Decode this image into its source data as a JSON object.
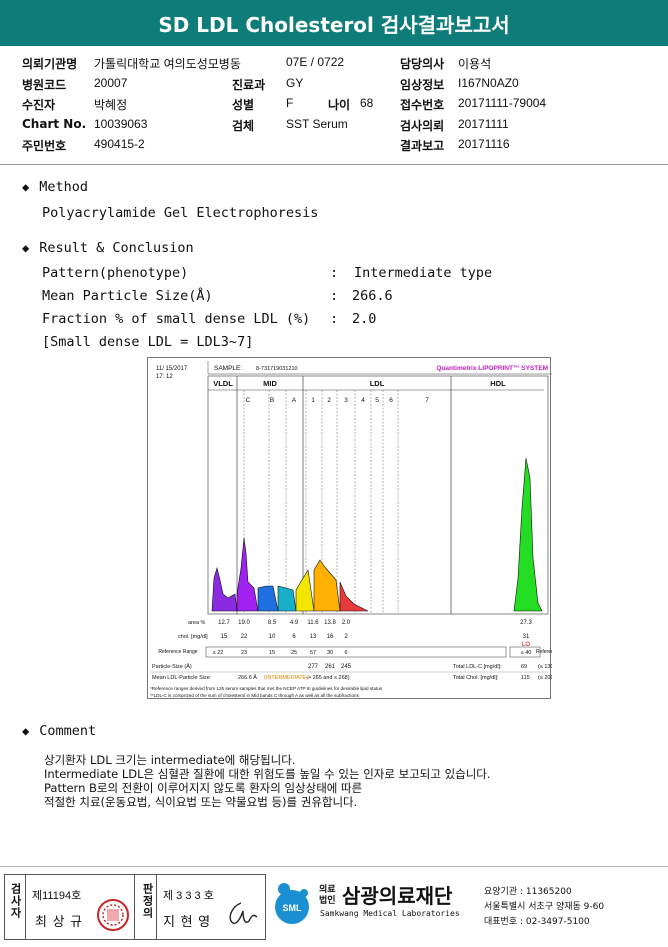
{
  "title": "SD LDL Cholesterol 검사결과보고서",
  "info": {
    "rows": [
      [
        {
          "l": "의뢰기관명",
          "v": "가톨릭대학교 여의도성모병동"
        },
        {
          "l": "",
          "v": "07E / 0722"
        },
        {
          "l": "담당의사",
          "v": "이용석"
        }
      ],
      [
        {
          "l": "병원코드",
          "v": "20007"
        },
        {
          "l": "진료과",
          "v": "GY"
        },
        {
          "l": "임상정보",
          "v": "I167N0AZ0"
        }
      ],
      [
        {
          "l": "수진자",
          "v": "박혜정"
        },
        {
          "l": "성별",
          "v": "F"
        },
        {
          "l": "접수번호",
          "v": "20171111-79004"
        }
      ],
      [
        {
          "l": "Chart No.",
          "v": "10039063"
        },
        {
          "l": "검체",
          "v": "SST Serum"
        },
        {
          "l": "검사의뢰",
          "v": "20171111"
        }
      ],
      [
        {
          "l": "주민번호",
          "v": "490415-2"
        },
        {
          "l": "",
          "v": ""
        },
        {
          "l": "결과보고",
          "v": "20171116"
        }
      ]
    ],
    "age_label": "나이",
    "age_value": "68"
  },
  "method": {
    "heading": "Method",
    "text": "Polyacrylamide Gel Electrophoresis"
  },
  "result": {
    "heading": "Result & Conclusion",
    "items": [
      {
        "label": "Pattern(phenotype)",
        "value": "Intermediate type"
      },
      {
        "label": "Mean Particle Size(Å)",
        "value": "266.6"
      },
      {
        "label": "Fraction % of small dense LDL (%)",
        "value": "2.0"
      }
    ],
    "note": "[Small dense LDL = LDL3~7]"
  },
  "graph": {
    "date": "11/ 15/2017",
    "time": "17: 12",
    "sample_label": "SAMPLE:",
    "sample_id": "8-731719031210",
    "system": "Quantimetrix LIPOPRINT™ SYSTEM",
    "groups": [
      "VLDL",
      "MID",
      "LDL",
      "HDL"
    ],
    "bands": [
      "C",
      "B",
      "A",
      "1",
      "2",
      "3",
      "4",
      "5",
      "6",
      "7"
    ],
    "area_label": "area %",
    "area_values": [
      "12.7",
      "19.0",
      "8.5",
      "4.9",
      "11.6",
      "13.8",
      "2.0",
      "27.3"
    ],
    "chol_label": "chol. [mg/dl]",
    "chol_values": [
      "15",
      "22",
      "10",
      "6",
      "13",
      "16",
      "2",
      "31"
    ],
    "lo_label": "LO",
    "ref_label": "Reference Range",
    "ref_values": [
      "≤ 22",
      "23",
      "15",
      "25",
      "57",
      "30",
      "6",
      "≥ 40"
    ],
    "particle_label": "Particle-Size (Å)",
    "particle_values": [
      "277",
      "261",
      "245"
    ],
    "mean_label": "Mean LDL-Particle Size:",
    "mean_value": "266.6 Å",
    "mean_type": "(INTERMEDIATE)",
    "mean_range": "-> 265 and ≤ 268)",
    "total_ldl_label": "Total LDL-C [mg/dl]:",
    "total_ldl_value": "69",
    "total_ldl_ref": "(≤ 130)",
    "total_chol_label": "Total Chol. [mg/dl]:",
    "total_chol_value": "115",
    "total_chol_ref": "(≤ 200)",
    "footnote1": "*Reference ranges derived from 125 serum samples that met the NCEP ATP III guidelines for desirable lipid status",
    "footnote2": "**LDL-C is comprized of the sum of cholesterol in Mid bands C through A as well as all the subfractions"
  },
  "comment": {
    "heading": "Comment",
    "lines": [
      "상기환자 LDL 크기는 intermediate에 해당됩니다.",
      "Intermediate LDL은 심혈관 질환에 대한 위험도를 높일 수 있는 인자로 보고되고 있습니다.",
      "Pattern B로의 전환이 이루어지지 않도록 환자의 임상상태에 따른",
      "적절한 치료(운동요법, 식이요법 또는 약물요법 등)를 권유합니다."
    ]
  },
  "footer": {
    "examiner_label": "검사자",
    "examiner_no": "제11194호",
    "examiner_name": "최 상 규",
    "reviewer_label": "판정의",
    "reviewer_no": "제 3 3 3 호",
    "reviewer_name": "지 현 영",
    "org_type": "의료 법인",
    "org_name": "삼광의료재단",
    "org_en": "Samkwang Medical Laboratories",
    "sml": "SML",
    "code_line": "요양기관 : 11365200",
    "address_line": "서울특별시 서초구 양재동 9-60",
    "phone_line": "대표번호 : 02-3497-5100"
  },
  "colors": {
    "title_bg": "#0e7d7a",
    "vldl": "#8a2be2",
    "mid_c": "#a020f0",
    "mid_b": "#1e6fe0",
    "mid_a": "#18b0c8",
    "ldl1": "#f2e600",
    "ldl2": "#ffb000",
    "ldl3": "#e83a3a",
    "hdl": "#22dd22"
  }
}
